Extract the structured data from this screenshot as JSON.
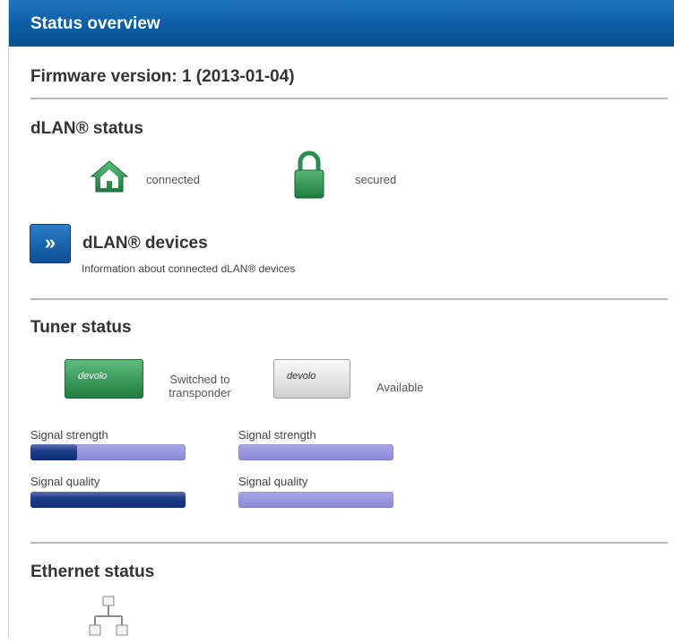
{
  "header": {
    "title": "Status overview"
  },
  "firmware": {
    "text": "Firmware version: 1 (2013-01-04)"
  },
  "dlan_status": {
    "title": "dLAN® status",
    "connection": {
      "icon": "house-icon",
      "label": "connected"
    },
    "security": {
      "icon": "lock-icon",
      "label": "secured"
    }
  },
  "dlan_devices": {
    "button_icon": "double-chevron-right-icon",
    "title": "dLAN® devices",
    "description": "Information about connected dLAN® devices"
  },
  "tuner_status": {
    "title": "Tuner status",
    "tuner1": {
      "icon": "devolo-stick-green-icon",
      "logo": "devolo",
      "label_line1": "Switched to",
      "label_line2": "transponder",
      "color": "#2e8b4a"
    },
    "tuner2": {
      "icon": "devolo-stick-grey-icon",
      "logo": "devolo",
      "label": "Available",
      "color": "#d8d8d8"
    },
    "signals": {
      "tuner1": {
        "strength_label": "Signal strength",
        "strength_level": 0.3,
        "quality_label": "Signal quality",
        "quality_level": 1.0
      },
      "tuner2": {
        "strength_label": "Signal strength",
        "strength_level": 0,
        "quality_label": "Signal quality",
        "quality_level": 0
      }
    }
  },
  "ethernet_status": {
    "title": "Ethernet status",
    "icon": "network-icon"
  },
  "colors": {
    "header": "#0b5aa0",
    "bar_empty": "#9a98dd",
    "bar_fill": "#1c3d8a"
  }
}
